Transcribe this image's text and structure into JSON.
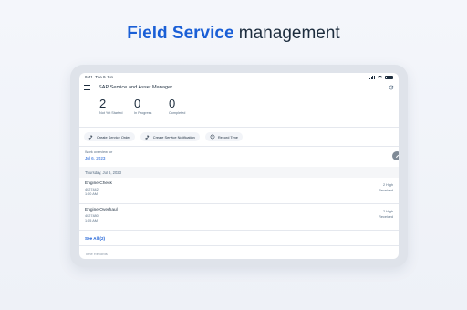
{
  "headline": {
    "accent": "Field Service",
    "rest": "management"
  },
  "status_bar": {
    "time": "9:41",
    "date": "Tue 9 Jun"
  },
  "app": {
    "title": "SAP Service and Asset Manager"
  },
  "counters": [
    {
      "value": "2",
      "label": "Not Yet Started"
    },
    {
      "value": "0",
      "label": "In Progress"
    },
    {
      "value": "0",
      "label": "Completed"
    }
  ],
  "actions": [
    {
      "label": "Create Service Order",
      "icon": "create-order-icon"
    },
    {
      "label": "Create Service Notification",
      "icon": "create-notification-icon"
    },
    {
      "label": "Record Time",
      "icon": "clock-icon"
    }
  ],
  "overview": {
    "label": "Work overview for",
    "date": "Jul 6, 2023"
  },
  "section": {
    "title": "Thursday, Jul 6, 2023"
  },
  "orders": [
    {
      "title": "Engine Check",
      "id": "4027442",
      "time": "1:00 AM",
      "priority": "2 High",
      "status": "Received"
    },
    {
      "title": "Engine Overhaul",
      "id": "4027480",
      "time": "1:05 AM",
      "priority": "2 High",
      "status": "Received"
    }
  ],
  "see_all": "See All (2)",
  "next_section": "Time Records",
  "colors": {
    "accent": "#1a5fd6",
    "text": "#1d2d3e",
    "muted": "#556b82"
  }
}
